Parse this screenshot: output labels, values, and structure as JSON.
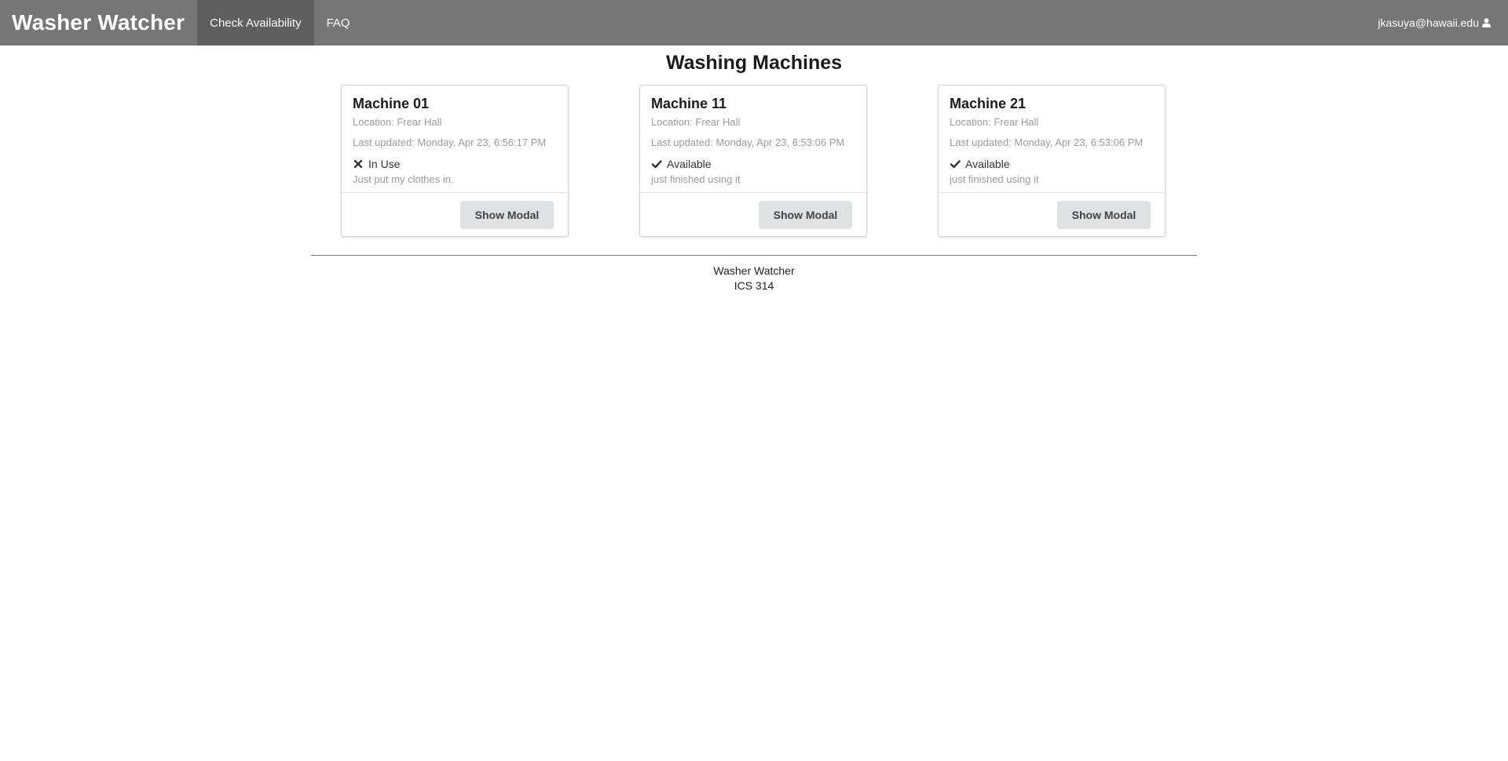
{
  "navbar": {
    "brand": "Washer Watcher",
    "items": [
      {
        "label": "Check Availability",
        "active": true
      },
      {
        "label": "FAQ",
        "active": false
      }
    ],
    "user": {
      "email": "jkasuya@hawaii.edu",
      "icon": "user-icon"
    }
  },
  "page": {
    "title": "Washing Machines"
  },
  "machines": [
    {
      "name": "Machine 01",
      "location": "Location: Frear Hall",
      "updated": "Last updated: Monday, Apr 23, 6:56:17 PM",
      "status": "In Use",
      "status_icon": "x-icon",
      "note": "Just put my clothes in.",
      "button": "Show Modal"
    },
    {
      "name": "Machine 11",
      "location": "Location: Frear Hall",
      "updated": "Last updated: Monday, Apr 23, 6:53:06 PM",
      "status": "Available",
      "status_icon": "check-icon",
      "note": "just finished using it",
      "button": "Show Modal"
    },
    {
      "name": "Machine 21",
      "location": "Location: Frear Hall",
      "updated": "Last updated: Monday, Apr 23, 6:53:06 PM",
      "status": "Available",
      "status_icon": "check-icon",
      "note": "just finished using it",
      "button": "Show Modal"
    }
  ],
  "footer": {
    "line1": "Washer Watcher",
    "line2": "ICS 314"
  },
  "colors": {
    "navbar": "#767676",
    "navbar_active": "#5f5f5f",
    "button": "#e0e1e2"
  }
}
